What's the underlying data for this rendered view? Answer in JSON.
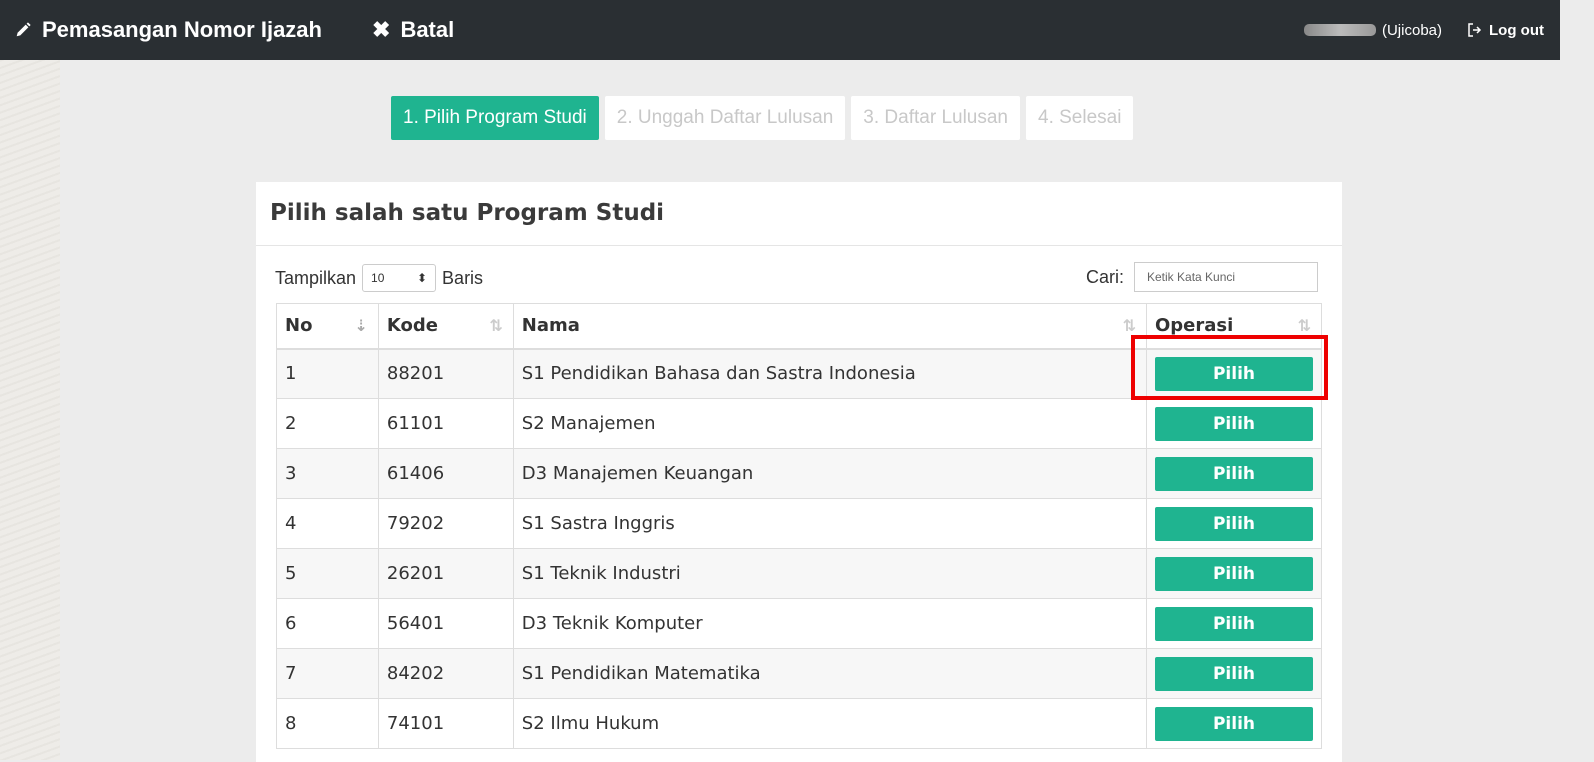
{
  "topbar": {
    "title": "Pemasangan Nomor Ijazah",
    "cancel_label": "Batal",
    "user_suffix": "(Ujicoba)",
    "logout_label": "Log out"
  },
  "steps": [
    {
      "label": "1. Pilih Program Studi",
      "active": true
    },
    {
      "label": "2. Unggah Daftar Lulusan",
      "active": false
    },
    {
      "label": "3. Daftar Lulusan",
      "active": false
    },
    {
      "label": "4. Selesai",
      "active": false
    }
  ],
  "panel": {
    "title": "Pilih salah satu Program Studi",
    "show_label": "Tampilkan",
    "show_value": "10",
    "rows_label": "Baris",
    "search_label": "Cari:",
    "search_placeholder": "Ketik Kata Kunci"
  },
  "table": {
    "headers": [
      "No",
      "Kode",
      "Nama",
      "Operasi"
    ],
    "rows": [
      {
        "no": "1",
        "kode": "88201",
        "nama": "S1 Pendidikan Bahasa dan Sastra Indonesia",
        "action": "Pilih"
      },
      {
        "no": "2",
        "kode": "61101",
        "nama": "S2 Manajemen",
        "action": "Pilih"
      },
      {
        "no": "3",
        "kode": "61406",
        "nama": "D3 Manajemen Keuangan",
        "action": "Pilih"
      },
      {
        "no": "4",
        "kode": "79202",
        "nama": "S1 Sastra Inggris",
        "action": "Pilih"
      },
      {
        "no": "5",
        "kode": "26201",
        "nama": "S1 Teknik Industri",
        "action": "Pilih"
      },
      {
        "no": "6",
        "kode": "56401",
        "nama": "D3 Teknik Komputer",
        "action": "Pilih"
      },
      {
        "no": "7",
        "kode": "84202",
        "nama": "S1 Pendidikan Matematika",
        "action": "Pilih"
      },
      {
        "no": "8",
        "kode": "74101",
        "nama": "S2 Ilmu Hukum",
        "action": "Pilih"
      }
    ]
  },
  "colors": {
    "accent": "#1fb490",
    "topbar": "#2a2f33",
    "highlight": "#ee0000"
  }
}
